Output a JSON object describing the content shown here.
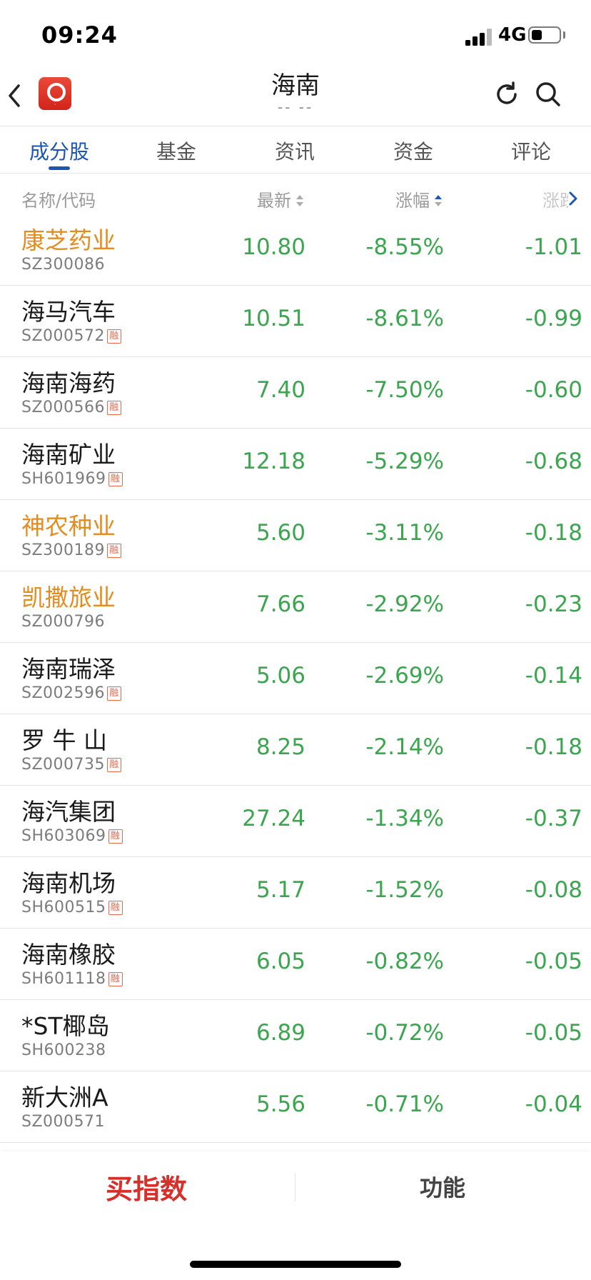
{
  "status": {
    "time": "09:24",
    "network": "4G"
  },
  "nav": {
    "title": "海南",
    "subtitle": "-- --"
  },
  "tabs": [
    {
      "label": "成分股",
      "active": true
    },
    {
      "label": "基金"
    },
    {
      "label": "资讯"
    },
    {
      "label": "资金"
    },
    {
      "label": "评论"
    }
  ],
  "columns": {
    "name": "名称/代码",
    "latest": "最新",
    "change_pct": "涨幅",
    "change": "涨跌"
  },
  "rows": [
    {
      "name": "康芝药业",
      "code": "SZ300086",
      "rong": "",
      "price": "10.80",
      "pct": "-8.55%",
      "chg": "-1.01"
    },
    {
      "name": "海马汽车",
      "code": "SZ000572",
      "rong": "融",
      "price": "10.51",
      "pct": "-8.61%",
      "chg": "-0.99"
    },
    {
      "name": "海南海药",
      "code": "SZ000566",
      "rong": "融",
      "price": "7.40",
      "pct": "-7.50%",
      "chg": "-0.60"
    },
    {
      "name": "海南矿业",
      "code": "SH601969",
      "rong": "融",
      "price": "12.18",
      "pct": "-5.29%",
      "chg": "-0.68"
    },
    {
      "name": "神农种业",
      "code": "SZ300189",
      "rong": "融",
      "price": "5.60",
      "pct": "-3.11%",
      "chg": "-0.18"
    },
    {
      "name": "凯撒旅业",
      "code": "SZ000796",
      "rong": "",
      "price": "7.66",
      "pct": "-2.92%",
      "chg": "-0.23"
    },
    {
      "name": "海南瑞泽",
      "code": "SZ002596",
      "rong": "融",
      "price": "5.06",
      "pct": "-2.69%",
      "chg": "-0.14"
    },
    {
      "name": "罗 牛 山",
      "code": "SZ000735",
      "rong": "融",
      "price": "8.25",
      "pct": "-2.14%",
      "chg": "-0.18"
    },
    {
      "name": "海汽集团",
      "code": "SH603069",
      "rong": "融",
      "price": "27.24",
      "pct": "-1.34%",
      "chg": "-0.37"
    },
    {
      "name": "海南机场",
      "code": "SH600515",
      "rong": "融",
      "price": "5.17",
      "pct": "-1.52%",
      "chg": "-0.08"
    },
    {
      "name": "海南橡胶",
      "code": "SH601118",
      "rong": "融",
      "price": "6.05",
      "pct": "-0.82%",
      "chg": "-0.05"
    },
    {
      "name": "*ST椰岛",
      "code": "SH600238",
      "rong": "",
      "price": "6.89",
      "pct": "-0.72%",
      "chg": "-0.05"
    },
    {
      "name": "新大洲A",
      "code": "SZ000571",
      "rong": "",
      "price": "5.56",
      "pct": "-0.71%",
      "chg": "-0.04"
    }
  ],
  "bottom": {
    "buy": "买指数",
    "func": "功能"
  },
  "colors": {
    "accent": "#1c56b4",
    "down": "#3aa64e",
    "highlight": "#e58c1f",
    "buy": "#d7302a"
  }
}
